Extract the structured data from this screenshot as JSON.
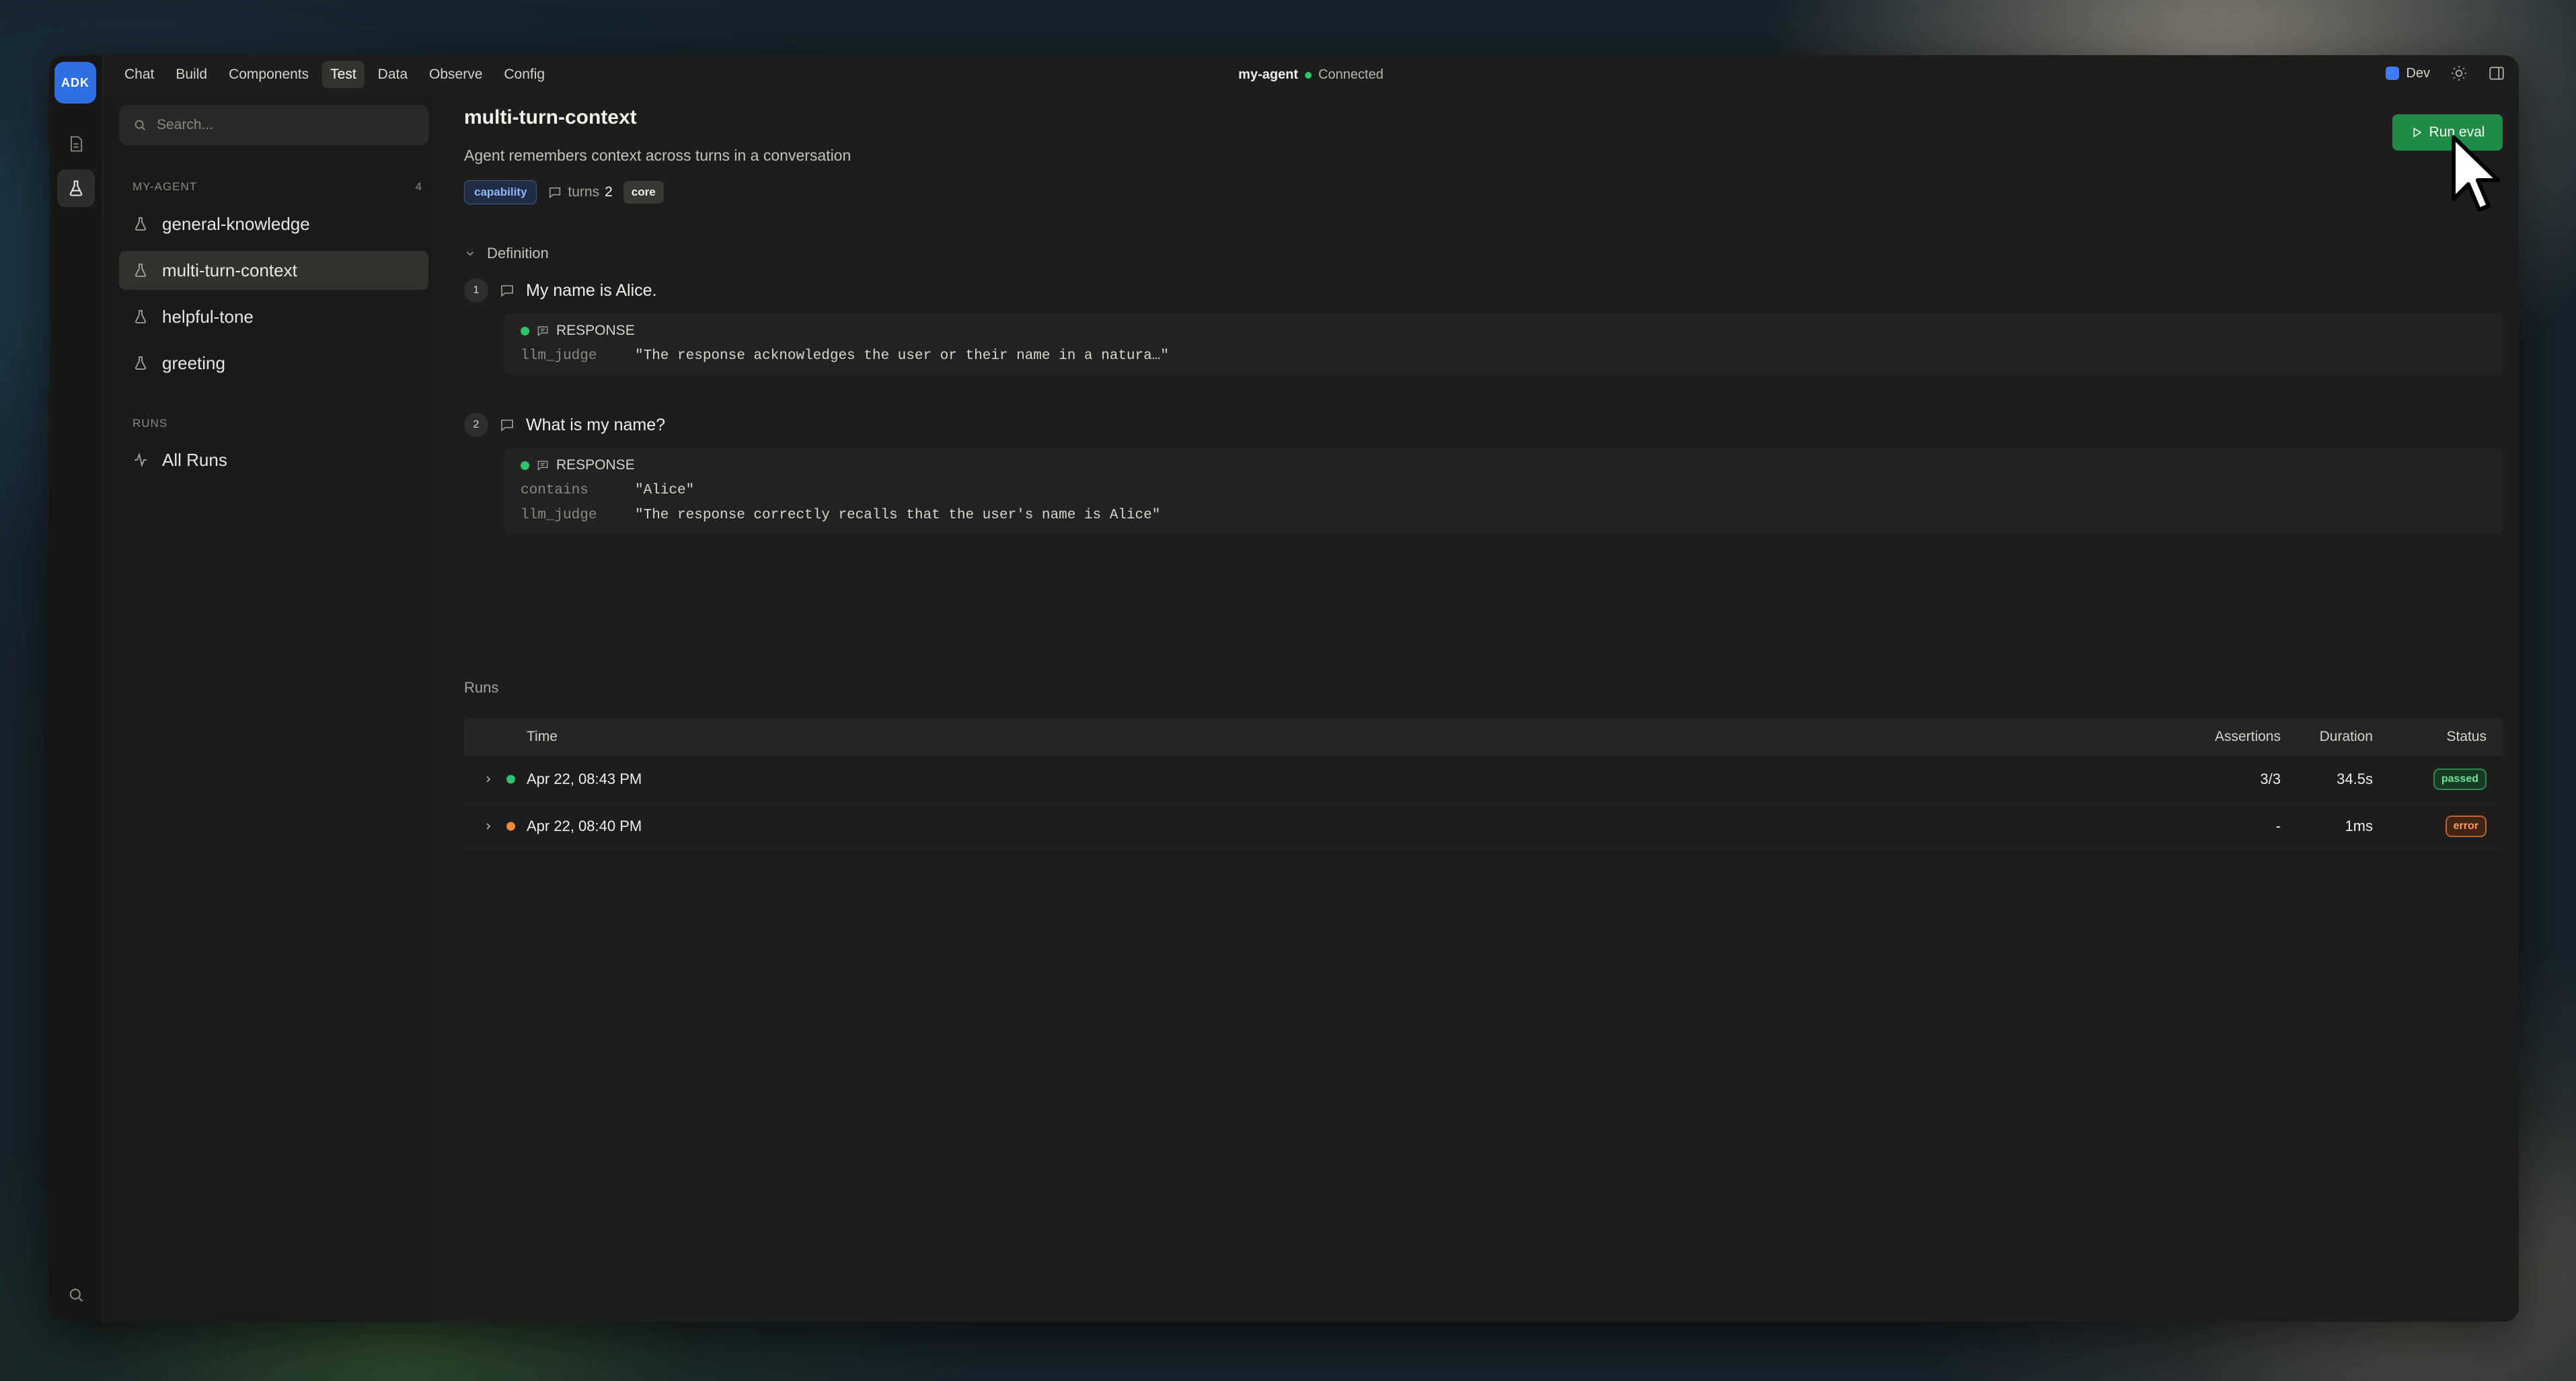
{
  "app": {
    "logo_text": "ADK",
    "agent_name": "my-agent",
    "connection_status": "Connected",
    "env_label": "Dev"
  },
  "nav": [
    "Chat",
    "Build",
    "Components",
    "Test",
    "Data",
    "Observe",
    "Config"
  ],
  "nav_active": "Test",
  "sidebar": {
    "search_placeholder": "Search...",
    "section_agent": "MY-AGENT",
    "section_agent_count": "4",
    "tests": [
      "general-knowledge",
      "multi-turn-context",
      "helpful-tone",
      "greeting"
    ],
    "active_test": "multi-turn-context",
    "section_runs": "RUNS",
    "all_runs": "All Runs"
  },
  "test": {
    "title": "multi-turn-context",
    "description": "Agent remembers context across turns in a conversation",
    "tag_capability": "capability",
    "turns_label": "turns",
    "turns_count": "2",
    "tag_core": "core",
    "run_button": "Run eval",
    "definition_label": "Definition",
    "turns": [
      {
        "num": "1",
        "message": "My name is Alice.",
        "response_label": "RESPONSE",
        "assertions": [
          {
            "type": "llm_judge",
            "value": "\"The response acknowledges the user or their name in a natura…\""
          }
        ]
      },
      {
        "num": "2",
        "message": "What is my name?",
        "response_label": "RESPONSE",
        "assertions": [
          {
            "type": "contains",
            "value": "\"Alice\""
          },
          {
            "type": "llm_judge",
            "value": "\"The response correctly recalls that the user's name is Alice\""
          }
        ]
      }
    ]
  },
  "runs": {
    "label": "Runs",
    "columns": {
      "time": "Time",
      "assertions": "Assertions",
      "duration": "Duration",
      "status": "Status"
    },
    "rows": [
      {
        "time": "Apr 22, 08:43 PM",
        "assertions": "3/3",
        "duration": "34.5s",
        "status": "passed",
        "dot_color": "#2ec26a"
      },
      {
        "time": "Apr 22, 08:40 PM",
        "assertions": "-",
        "duration": "1ms",
        "status": "error",
        "dot_color": "#f08a3c"
      }
    ]
  },
  "colors": {
    "accent_green": "#1f8b45",
    "brand_blue": "#2f6fe4",
    "passed": "#6fe39a",
    "error": "#ff9c5c"
  }
}
